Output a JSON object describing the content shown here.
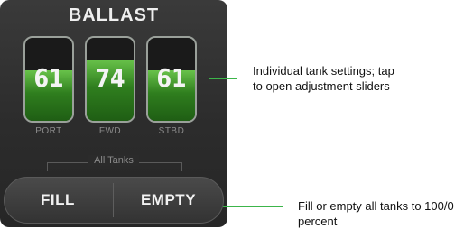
{
  "ballast_panel": {
    "title": "BALLAST",
    "tanks": [
      {
        "id": "port",
        "value": "61",
        "label": "PORT",
        "fill_percent": 61
      },
      {
        "id": "fwd",
        "value": "74",
        "label": "FWD",
        "fill_percent": 74
      },
      {
        "id": "stbd",
        "value": "61",
        "label": "STBD",
        "fill_percent": 61
      }
    ],
    "all_tanks_label": "All Tanks",
    "fill_button": "FILL",
    "empty_button": "EMPTY"
  },
  "callouts": {
    "tanks": "Individual tank settings; tap to open adjustment sliders",
    "buttons": "Fill or empty all tanks to 100/0 percent"
  },
  "colors": {
    "panel_background": "#2c2c2c",
    "tank_fill": "#3a8f28",
    "callout_line": "#3cb54a"
  }
}
